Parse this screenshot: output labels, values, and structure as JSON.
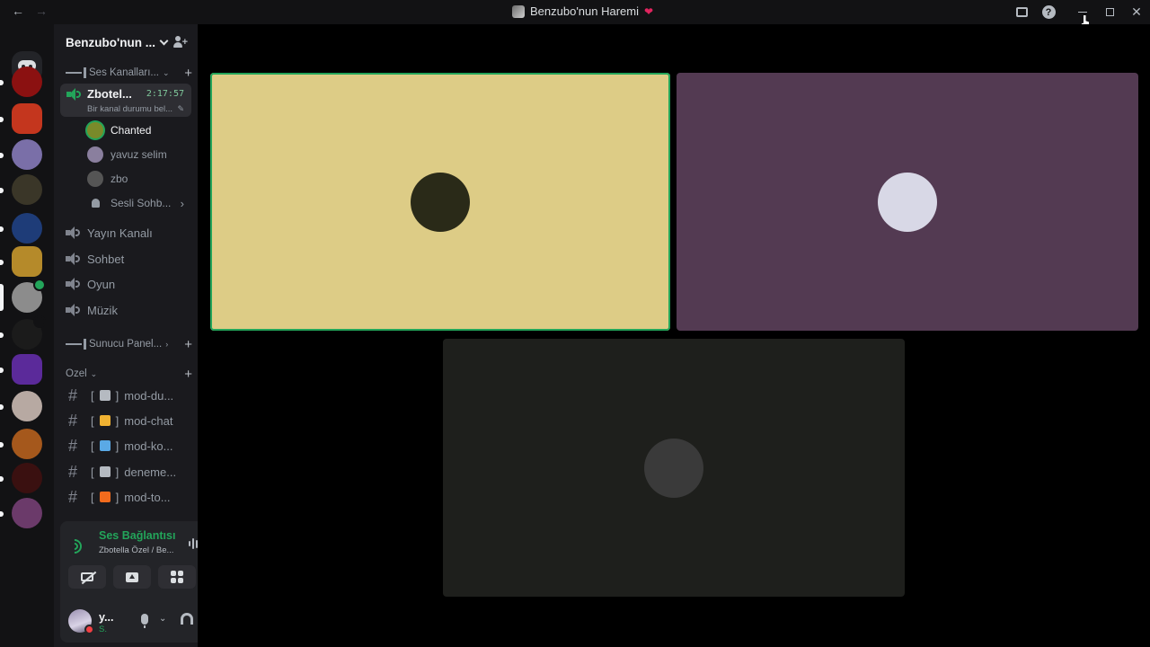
{
  "titlebar": {
    "title": "Benzubo'nun Haremi",
    "back_icon": "←",
    "forward_icon": "→"
  },
  "server_rail": {
    "servers": [
      {
        "name": "server-1",
        "color": "#8b1111"
      },
      {
        "name": "server-2",
        "color": "#c4361e"
      },
      {
        "name": "server-3",
        "color": "#7a6fa8"
      },
      {
        "name": "server-4",
        "color": "#3a3628"
      },
      {
        "name": "server-5",
        "color": "#1e3c78"
      },
      {
        "name": "server-6",
        "color": "#b58a2a"
      },
      {
        "name": "server-7",
        "color": "#8c8c8c"
      },
      {
        "name": "server-8",
        "color": "#1b1b1b"
      },
      {
        "name": "server-9",
        "color": "#5b2a9a"
      },
      {
        "name": "server-10",
        "color": "#b7a9a2"
      },
      {
        "name": "server-11",
        "color": "#a5581c"
      },
      {
        "name": "server-12",
        "color": "#3a1010"
      },
      {
        "name": "server-13",
        "color": "#6b3a6a"
      }
    ]
  },
  "sidebar": {
    "server_name": "Benzubo'nun ...",
    "categories": {
      "voice": "Ses Kanalları...",
      "panel": "Sunucu Panel...",
      "special": "Özel"
    },
    "active_channel": {
      "name": "Zbotel...",
      "timer": "2:17:57",
      "status": "Bir kanal durumu bel..."
    },
    "voice_users": [
      {
        "name": "Chanted",
        "speaking": true,
        "color": "#7a8a2a"
      },
      {
        "name": "yavuz selim",
        "speaking": false,
        "color": "#8a7f9e"
      },
      {
        "name": "zbo",
        "speaking": false,
        "color": "#555555"
      }
    ],
    "voice_chat_label": "Sesli Sohb...",
    "voice_channels": [
      "Yayın Kanalı",
      "Sohbet",
      "Oyun",
      "Müzik"
    ],
    "text_channels": [
      {
        "name": "mod-du...",
        "bracket_open": "[",
        "bracket_close": "]",
        "icon": "hammer-icon",
        "color": "#b5bac1"
      },
      {
        "name": "mod-chat",
        "bracket_open": "[",
        "bracket_close": "]",
        "icon": "key-icon",
        "color": "#f0b232"
      },
      {
        "name": "mod-ko...",
        "bracket_open": "[",
        "bracket_close": "]",
        "icon": "laptop-icon",
        "color": "#5aa9e6"
      },
      {
        "name": "deneme...",
        "bracket_open": "[",
        "bracket_close": "]",
        "icon": "gear-icon",
        "color": "#b5bac1"
      },
      {
        "name": "mod-to...",
        "bracket_open": "[",
        "bracket_close": "]",
        "icon": "fire-icon",
        "color": "#f26b1d"
      }
    ]
  },
  "voice_panel": {
    "title": "Ses Bağlantısı K",
    "subtitle": "Zbotella Özel / Be..."
  },
  "user_panel": {
    "name": "y...",
    "status": "S."
  },
  "tiles": [
    {
      "name": "tile-chanted",
      "bg": "#ddcc86",
      "avatar": "#2a2a18",
      "speaking": true
    },
    {
      "name": "tile-yavuz-selim",
      "bg": "#533a52",
      "avatar": "#d8d8e6",
      "speaking": false
    },
    {
      "name": "tile-zbo",
      "bg": "#1e1f1c",
      "avatar": "#3a3a3a",
      "speaking": false
    }
  ],
  "colors": {
    "speaking": "#23a55a",
    "rail_bg": "#121214",
    "sidebar_bg": "#1a1a1e"
  }
}
